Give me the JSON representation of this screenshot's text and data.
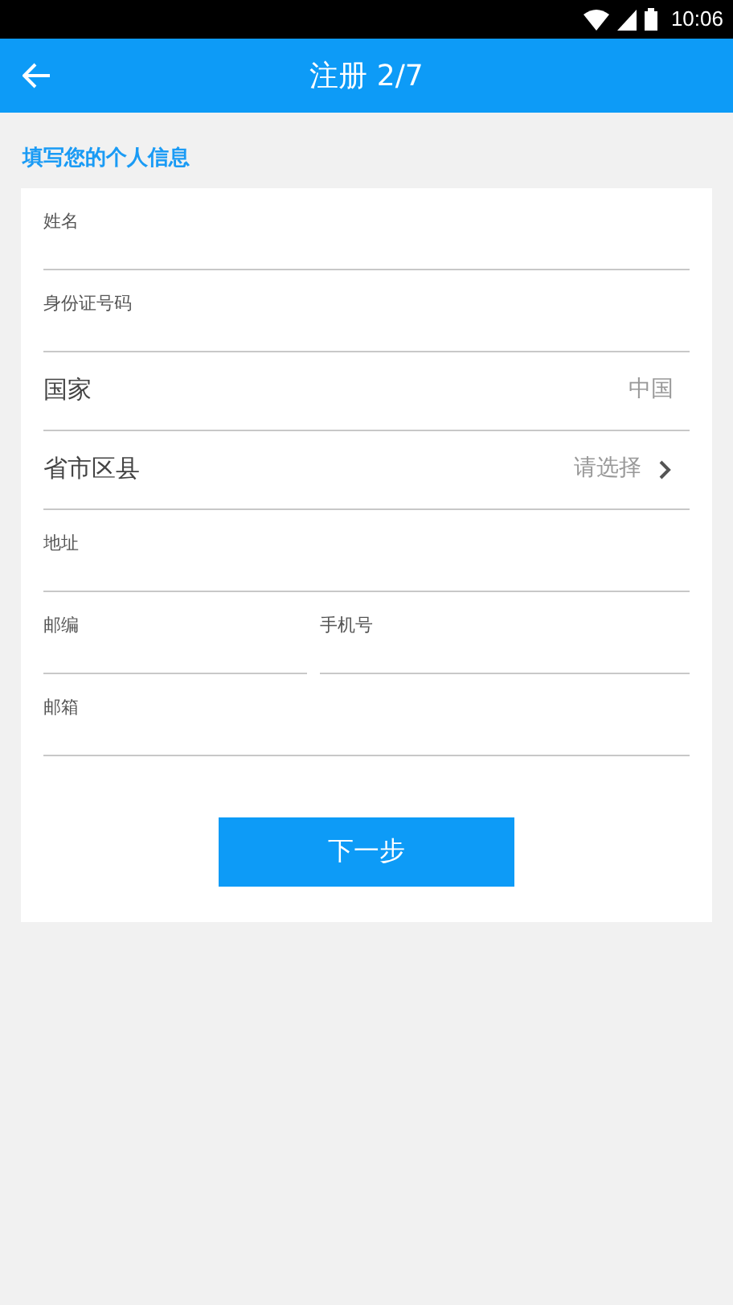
{
  "status_bar": {
    "time": "10:06"
  },
  "header": {
    "title": "注册 2/7"
  },
  "section_title": "填写您的个人信息",
  "fields": [
    {
      "kind": "input",
      "label": "姓名"
    },
    {
      "kind": "input",
      "label": "身份证号码"
    },
    {
      "kind": "select",
      "label": "国家",
      "value": "中国",
      "chevron": false
    },
    {
      "kind": "select",
      "label": "省市区县",
      "value": "请选择",
      "chevron": true
    },
    {
      "kind": "input",
      "label": "地址"
    },
    {
      "kind": "pair",
      "fields": [
        {
          "label": "邮编"
        },
        {
          "label": "手机号"
        }
      ]
    },
    {
      "kind": "input",
      "label": "邮箱"
    }
  ],
  "button": "下一步"
}
